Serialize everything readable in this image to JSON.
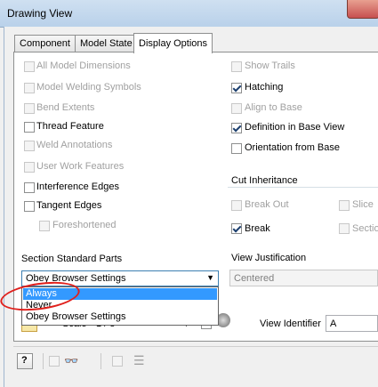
{
  "window": {
    "title": "Drawing View"
  },
  "tabs": [
    {
      "label": "Component"
    },
    {
      "label": "Model State"
    },
    {
      "label": "Display Options"
    }
  ],
  "left_options": [
    {
      "label": "All Model Dimensions",
      "checked": false,
      "enabled": false
    },
    {
      "label": "Model Welding Symbols",
      "checked": false,
      "enabled": false
    },
    {
      "label": "Bend Extents",
      "checked": false,
      "enabled": false
    },
    {
      "label": "Thread Feature",
      "checked": false,
      "enabled": true
    },
    {
      "label": "Weld Annotations",
      "checked": false,
      "enabled": false
    },
    {
      "label": "User Work Features",
      "checked": false,
      "enabled": false
    },
    {
      "label": "Interference Edges",
      "checked": false,
      "enabled": true
    },
    {
      "label": "Tangent Edges",
      "checked": false,
      "enabled": true
    },
    {
      "label": "Foreshortened",
      "checked": false,
      "enabled": false
    }
  ],
  "right_options": [
    {
      "label": "Show Trails",
      "checked": false,
      "enabled": false
    },
    {
      "label": "Hatching",
      "checked": true,
      "enabled": true
    },
    {
      "label": "Align to Base",
      "checked": false,
      "enabled": false
    },
    {
      "label": "Definition in Base View",
      "checked": true,
      "enabled": true
    },
    {
      "label": "Orientation from Base",
      "checked": false,
      "enabled": true
    }
  ],
  "cut_inheritance": {
    "title": "Cut Inheritance",
    "options": [
      {
        "label": "Break Out",
        "checked": false,
        "enabled": false
      },
      {
        "label": "Slice",
        "checked": false,
        "enabled": false
      },
      {
        "label": "Break",
        "checked": true,
        "enabled": true
      },
      {
        "label": "Section",
        "checked": false,
        "enabled": false
      }
    ]
  },
  "section_standard_parts": {
    "title": "Section Standard Parts",
    "selected": "Obey Browser Settings",
    "options": [
      "Always",
      "Never",
      "Obey Browser Settings"
    ],
    "highlighted": "Always"
  },
  "view_justification": {
    "title": "View Justification",
    "value": "Centered"
  },
  "scale": {
    "label": "Scale",
    "value": "1 / 8"
  },
  "view_identifier": {
    "label": "View Identifier",
    "value": "A"
  },
  "colors": {
    "accent": "#3399ff",
    "annotation_red": "#e0201c"
  }
}
